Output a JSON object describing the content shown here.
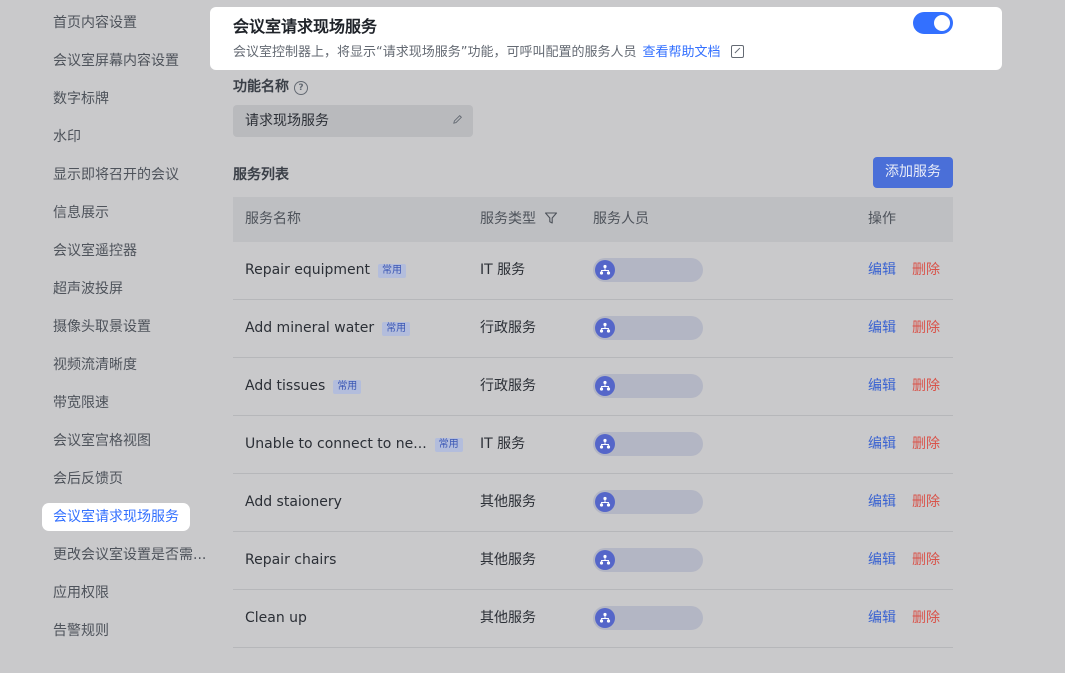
{
  "sidebar": {
    "items": [
      {
        "label": "首页内容设置",
        "active": false
      },
      {
        "label": "会议室屏幕内容设置",
        "active": false
      },
      {
        "label": "数字标牌",
        "active": false
      },
      {
        "label": "水印",
        "active": false
      },
      {
        "label": "显示即将召开的会议",
        "active": false
      },
      {
        "label": "信息展示",
        "active": false
      },
      {
        "label": "会议室遥控器",
        "active": false
      },
      {
        "label": "超声波投屏",
        "active": false
      },
      {
        "label": "摄像头取景设置",
        "active": false
      },
      {
        "label": "视频流清晰度",
        "active": false
      },
      {
        "label": "带宽限速",
        "active": false
      },
      {
        "label": "会议室宫格视图",
        "active": false
      },
      {
        "label": "会后反馈页",
        "active": false
      },
      {
        "label": "会议室请求现场服务",
        "active": true
      },
      {
        "label": "更改会议室设置是否需...",
        "active": false
      },
      {
        "label": "应用权限",
        "active": false
      },
      {
        "label": "告警规则",
        "active": false
      }
    ]
  },
  "feature": {
    "title": "会议室请求现场服务",
    "description": "会议室控制器上，将显示“请求现场服务”功能，可呼叫配置的服务人员",
    "help_link": "查看帮助文档",
    "enabled": true
  },
  "function_name": {
    "label": "功能名称",
    "value": "请求现场服务"
  },
  "service_list": {
    "label": "服务列表",
    "add_button": "添加服务",
    "columns": {
      "name": "服务名称",
      "type": "服务类型",
      "staff": "服务人员",
      "actions": "操作"
    },
    "rows": [
      {
        "name": "Repair equipment",
        "tag": "常用",
        "type": "IT 服务",
        "edit": "编辑",
        "delete": "删除"
      },
      {
        "name": "Add mineral water",
        "tag": "常用",
        "type": "行政服务",
        "edit": "编辑",
        "delete": "删除"
      },
      {
        "name": "Add tissues",
        "tag": "常用",
        "type": "行政服务",
        "edit": "编辑",
        "delete": "删除"
      },
      {
        "name": "Unable to connect to ne...",
        "tag": "常用",
        "type": "IT 服务",
        "edit": "编辑",
        "delete": "删除"
      },
      {
        "name": "Add staionery",
        "tag": "",
        "type": "其他服务",
        "edit": "编辑",
        "delete": "删除"
      },
      {
        "name": "Repair chairs",
        "tag": "",
        "type": "其他服务",
        "edit": "编辑",
        "delete": "删除"
      },
      {
        "name": "Clean up",
        "tag": "",
        "type": "其他服务",
        "edit": "编辑",
        "delete": "删除"
      }
    ]
  },
  "colors": {
    "accent": "#3370ff",
    "danger": "#d9534a",
    "backdrop": "#c9c9cb"
  }
}
